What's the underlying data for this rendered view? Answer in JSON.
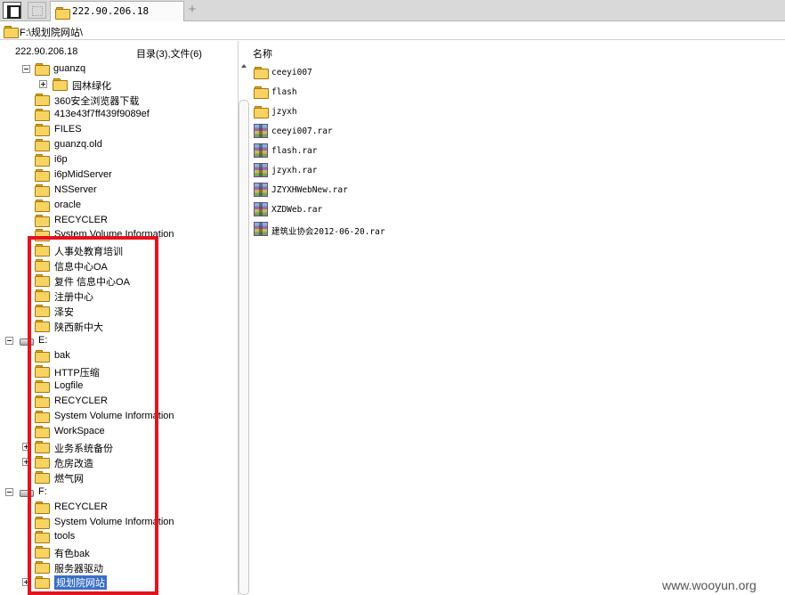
{
  "tabbar": {
    "tab_title": "222.90.206.18",
    "add_symbol": "+"
  },
  "path": "F:\\规划院网站\\",
  "left_panel": {
    "host": "222.90.206.18",
    "summary": "目录(3),文件(6)"
  },
  "right_panel": {
    "column_header": "名称"
  },
  "tree": [
    {
      "label": "guanzq",
      "level": "sub-expanded",
      "expander": "minus"
    },
    {
      "label": "园林绿化",
      "level": "sub-sub",
      "expander": "plus"
    },
    {
      "label": "360安全浏览器下载"
    },
    {
      "label": "413e43f7ff439f9089ef"
    },
    {
      "label": "FILES"
    },
    {
      "label": "guanzq.old"
    },
    {
      "label": "i6p"
    },
    {
      "label": "i6pMidServer"
    },
    {
      "label": "NSServer"
    },
    {
      "label": "oracle"
    },
    {
      "label": "RECYCLER"
    },
    {
      "label": "System Volume Information"
    },
    {
      "label": "人事处教育培训"
    },
    {
      "label": "信息中心OA"
    },
    {
      "label": "复件 信息中心OA"
    },
    {
      "label": "注册中心"
    },
    {
      "label": "泽安"
    },
    {
      "label": "陕西新中大"
    },
    {
      "label": "E:",
      "type": "drive",
      "expander": "minus"
    },
    {
      "label": "bak"
    },
    {
      "label": "HTTP压缩"
    },
    {
      "label": "Logfile"
    },
    {
      "label": "RECYCLER"
    },
    {
      "label": "System Volume Information"
    },
    {
      "label": "WorkSpace"
    },
    {
      "label": "业务系统备份",
      "expander": "plus"
    },
    {
      "label": "危房改造",
      "expander": "plus"
    },
    {
      "label": "燃气网"
    },
    {
      "label": "F:",
      "type": "drive",
      "expander": "minus"
    },
    {
      "label": "RECYCLER"
    },
    {
      "label": "System Volume Information"
    },
    {
      "label": "tools"
    },
    {
      "label": "有色bak"
    },
    {
      "label": "服务器驱动"
    },
    {
      "label": "规划院网站",
      "expander": "plus",
      "selected": true
    }
  ],
  "files": [
    {
      "name": "ceeyi007",
      "icon": "folder-icon"
    },
    {
      "name": "flash",
      "icon": "folder-icon"
    },
    {
      "name": "jzyxh",
      "icon": "folder-icon"
    },
    {
      "name": "ceeyi007.rar",
      "icon": "rar-icon"
    },
    {
      "name": "flash.rar",
      "icon": "rar-icon"
    },
    {
      "name": "jzyxh.rar",
      "icon": "rar-icon"
    },
    {
      "name": "JZYXHWebNew.rar",
      "icon": "rar-icon"
    },
    {
      "name": "XZDWeb.rar",
      "icon": "rar-icon"
    },
    {
      "name": "建筑业协会2012-06-20.rar",
      "icon": "rar-icon"
    }
  ],
  "watermark": "www.wooyun.org",
  "colors": {
    "highlight": "#e4131e",
    "selection": "#3a6fc8",
    "folder": "#f7d364"
  }
}
